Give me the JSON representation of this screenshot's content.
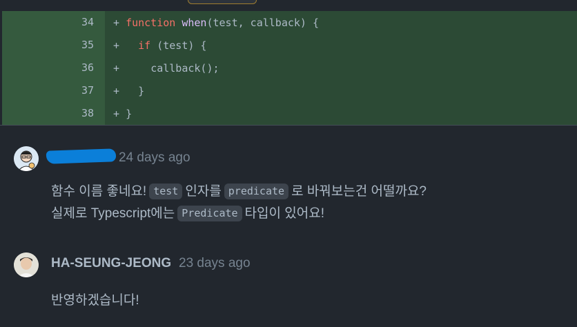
{
  "diff": {
    "rows": [
      {
        "lineno": "34",
        "prefix": "+ ",
        "parts": [
          {
            "t": "function",
            "c": "kw"
          },
          {
            "t": " ",
            "c": "pl"
          },
          {
            "t": "when",
            "c": "fn"
          },
          {
            "t": "(test, callback) {",
            "c": "pl"
          }
        ]
      },
      {
        "lineno": "35",
        "prefix": "+   ",
        "parts": [
          {
            "t": "if",
            "c": "kw"
          },
          {
            "t": " (test) {",
            "c": "pl"
          }
        ]
      },
      {
        "lineno": "36",
        "prefix": "+     ",
        "parts": [
          {
            "t": "callback();",
            "c": "pl"
          }
        ]
      },
      {
        "lineno": "37",
        "prefix": "+   ",
        "parts": [
          {
            "t": "}",
            "c": "pl"
          }
        ]
      },
      {
        "lineno": "38",
        "prefix": "+ ",
        "parts": [
          {
            "t": "}",
            "c": "pl"
          }
        ]
      }
    ]
  },
  "comments": [
    {
      "author": "",
      "time": "24 days ago",
      "lines": [
        [
          {
            "t": "함수 이름 좋네요!"
          },
          {
            "code": "test"
          },
          {
            "t": "인자를"
          },
          {
            "code": "predicate"
          },
          {
            "t": "로 바꿔보는건 어떨까요?"
          }
        ],
        [
          {
            "t": "실제로 Typescript에는"
          },
          {
            "code": "Predicate"
          },
          {
            "t": "타입이 있어요!"
          }
        ]
      ]
    },
    {
      "author": "HA-SEUNG-JEONG",
      "time": "23 days ago",
      "lines": [
        [
          {
            "t": "반영하겠습니다!"
          }
        ]
      ]
    }
  ],
  "colors": {
    "diff_bg": "#2c4a35",
    "keyword": "#f47067",
    "function_name": "#dcbdfb",
    "redaction": "#0b7fd9"
  }
}
